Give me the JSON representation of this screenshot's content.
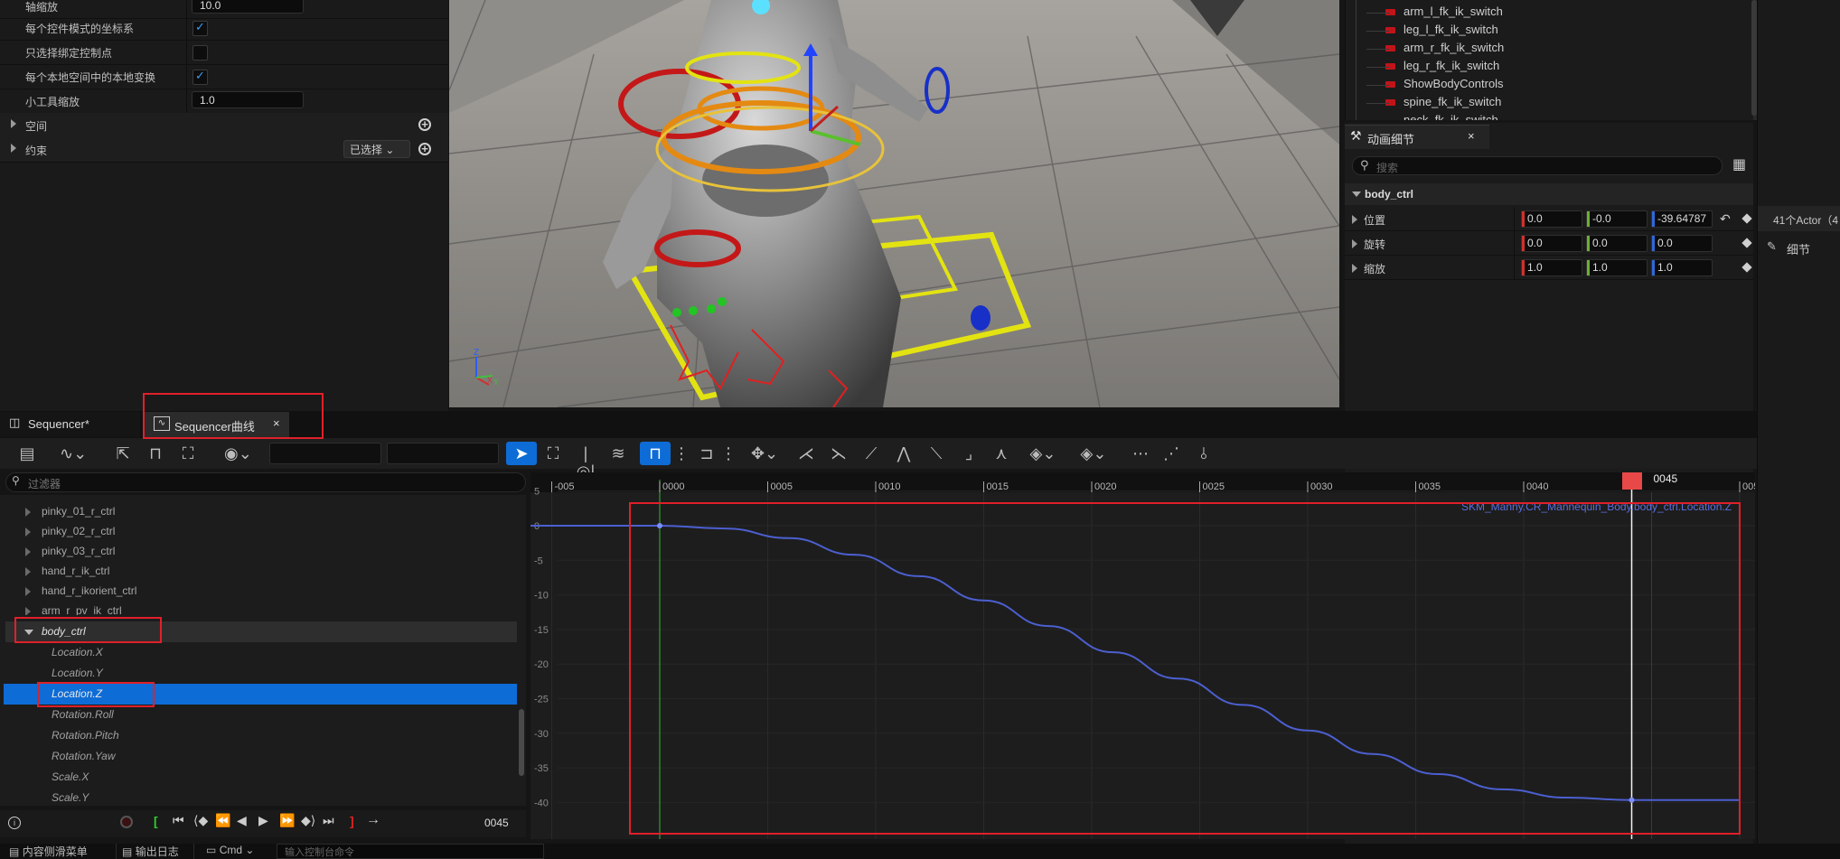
{
  "details": {
    "rows": [
      {
        "label": "轴缩放",
        "value": "10.0"
      },
      {
        "label": "每个控件模式的坐标系",
        "checked": true
      },
      {
        "label": "只选择绑定控制点",
        "checked": false
      },
      {
        "label": "每个本地空间中的本地变换",
        "checked": true
      },
      {
        "label": "小工具缩放",
        "value": "1.0"
      }
    ],
    "sections": {
      "space": "空间",
      "constraint": "约束",
      "constraint_dropdown": "已选择"
    }
  },
  "viewport": {
    "axis_labels": {
      "z": "Z",
      "x": "X",
      "y": "Y"
    }
  },
  "outliner": {
    "items": [
      "arm_l_fk_ik_switch",
      "leg_l_fk_ik_switch",
      "arm_r_fk_ik_switch",
      "leg_r_fk_ik_switch",
      "ShowBodyControls",
      "spine_fk_ik_switch",
      "neck_fk_ik_switch"
    ]
  },
  "anim_details": {
    "tab_label": "动画细节",
    "search_placeholder": "搜索",
    "section": "body_ctrl",
    "location": {
      "label": "位置",
      "x": "0.0",
      "y": "-0.0",
      "z": "-39.64787"
    },
    "rotation": {
      "label": "旋转",
      "x": "0.0",
      "y": "0.0",
      "z": "0.0"
    },
    "scale": {
      "label": "缩放",
      "x": "1.0",
      "y": "1.0",
      "z": "1.0"
    }
  },
  "far_right": {
    "actor_count": "41个Actor（4",
    "details_tab": "细节"
  },
  "sequencer": {
    "tab1": "Sequencer*",
    "tab2": "Sequencer曲线",
    "filter_placeholder": "过滤器",
    "tree": [
      {
        "label": "pinky_01_r_ctrl",
        "kind": "node"
      },
      {
        "label": "pinky_02_r_ctrl",
        "kind": "node"
      },
      {
        "label": "pinky_03_r_ctrl",
        "kind": "node"
      },
      {
        "label": "hand_r_ik_ctrl",
        "kind": "node"
      },
      {
        "label": "hand_r_ikorient_ctrl",
        "kind": "node"
      },
      {
        "label": "arm_r_pv_ik_ctrl",
        "kind": "node"
      },
      {
        "label": "body_ctrl",
        "kind": "expanded"
      },
      {
        "label": "Location.X",
        "kind": "channel"
      },
      {
        "label": "Location.Y",
        "kind": "channel"
      },
      {
        "label": "Location.Z",
        "kind": "selected"
      },
      {
        "label": "Rotation.Roll",
        "kind": "channel"
      },
      {
        "label": "Rotation.Pitch",
        "kind": "channel"
      },
      {
        "label": "Rotation.Yaw",
        "kind": "channel"
      },
      {
        "label": "Scale.X",
        "kind": "channel"
      },
      {
        "label": "Scale.Y",
        "kind": "channel"
      }
    ],
    "current_frame": "0045",
    "playhead_label": "0045",
    "curve_label": "SKM_Manny.CR_Mannequin_Body.body_ctrl.Location.Z",
    "ruler_ticks": [
      "-005",
      "0000",
      "0005",
      "0010",
      "0015",
      "0020",
      "0025",
      "0030",
      "0035",
      "0040",
      "0045",
      "005"
    ],
    "y_ticks": [
      "5",
      "0",
      "-5",
      "-10",
      "-15",
      "-20",
      "-25",
      "-30",
      "-35",
      "-40"
    ]
  },
  "bottom": {
    "content_drawer": "内容侧滑菜单",
    "output_log": "输出日志",
    "cmd": "Cmd",
    "console_placeholder": "输入控制台命令"
  },
  "curve_data": {
    "x": [
      -8,
      0,
      3,
      6,
      9,
      12,
      15,
      18,
      21,
      24,
      27,
      30,
      33,
      36,
      39,
      42,
      45,
      50
    ],
    "y": [
      0,
      0,
      -0.4,
      -1.8,
      -4.2,
      -7.3,
      -10.8,
      -14.5,
      -18.3,
      -22.1,
      -25.9,
      -29.6,
      -33.0,
      -35.9,
      -38.1,
      -39.3,
      -39.65,
      -39.65
    ]
  }
}
